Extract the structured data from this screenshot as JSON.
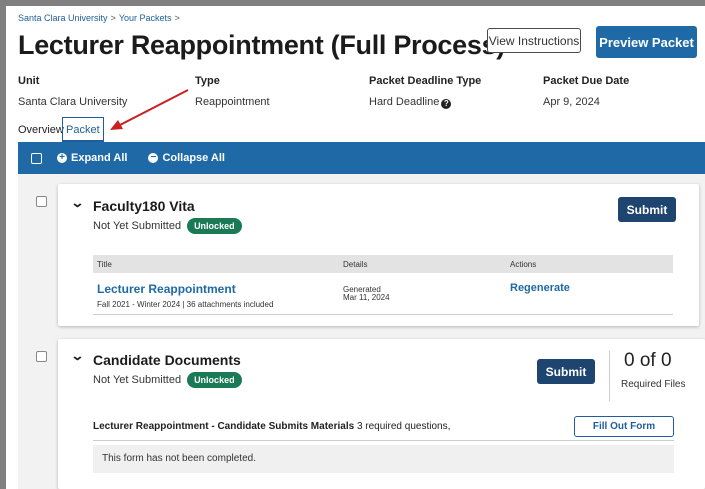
{
  "breadcrumb": {
    "items": [
      "Santa Clara University",
      "Your Packets"
    ],
    "separator": ">"
  },
  "page": {
    "title": "Lecturer Reappointment (Full Process)"
  },
  "header_buttons": {
    "instructions": "View Instructions",
    "preview": "Preview Packet"
  },
  "meta": {
    "unit_label": "Unit",
    "unit_value": "Santa Clara University",
    "type_label": "Type",
    "type_value": "Reappointment",
    "deadline_type_label": "Packet Deadline Type",
    "deadline_type_value": "Hard Deadline",
    "due_label": "Packet Due Date",
    "due_value": "Apr 9, 2024"
  },
  "tabs": {
    "overview": "Overview",
    "packet": "Packet"
  },
  "toolbar": {
    "expand": "Expand All",
    "collapse": "Collapse All"
  },
  "sections": {
    "faculty": {
      "title": "Faculty180 Vita",
      "status": "Not Yet Submitted",
      "badge": "Unlocked",
      "submit": "Submit",
      "table": {
        "headers": {
          "title": "Title",
          "details": "Details",
          "actions": "Actions"
        },
        "row": {
          "title": "Lecturer Reappointment",
          "subtitle": "Fall 2021 - Winter 2024 | 36 attachments included",
          "details_label": "Generated",
          "details_date": "Mar 11, 2024",
          "action": "Regenerate"
        }
      }
    },
    "candidate": {
      "title": "Candidate Documents",
      "status": "Not Yet Submitted",
      "badge": "Unlocked",
      "submit": "Submit",
      "required_count": "0 of 0",
      "required_label": "Required Files",
      "form_name": "Lecturer Reappointment - Candidate Submits Materials",
      "form_questions": "3 required questions,",
      "fill_button": "Fill Out Form",
      "form_note": "This form has not been completed."
    }
  },
  "colors": {
    "primary": "#1f6aa6",
    "dark_button": "#1e4470",
    "badge": "#1b7a56",
    "annotation_arrow": "#cc1f1f"
  }
}
